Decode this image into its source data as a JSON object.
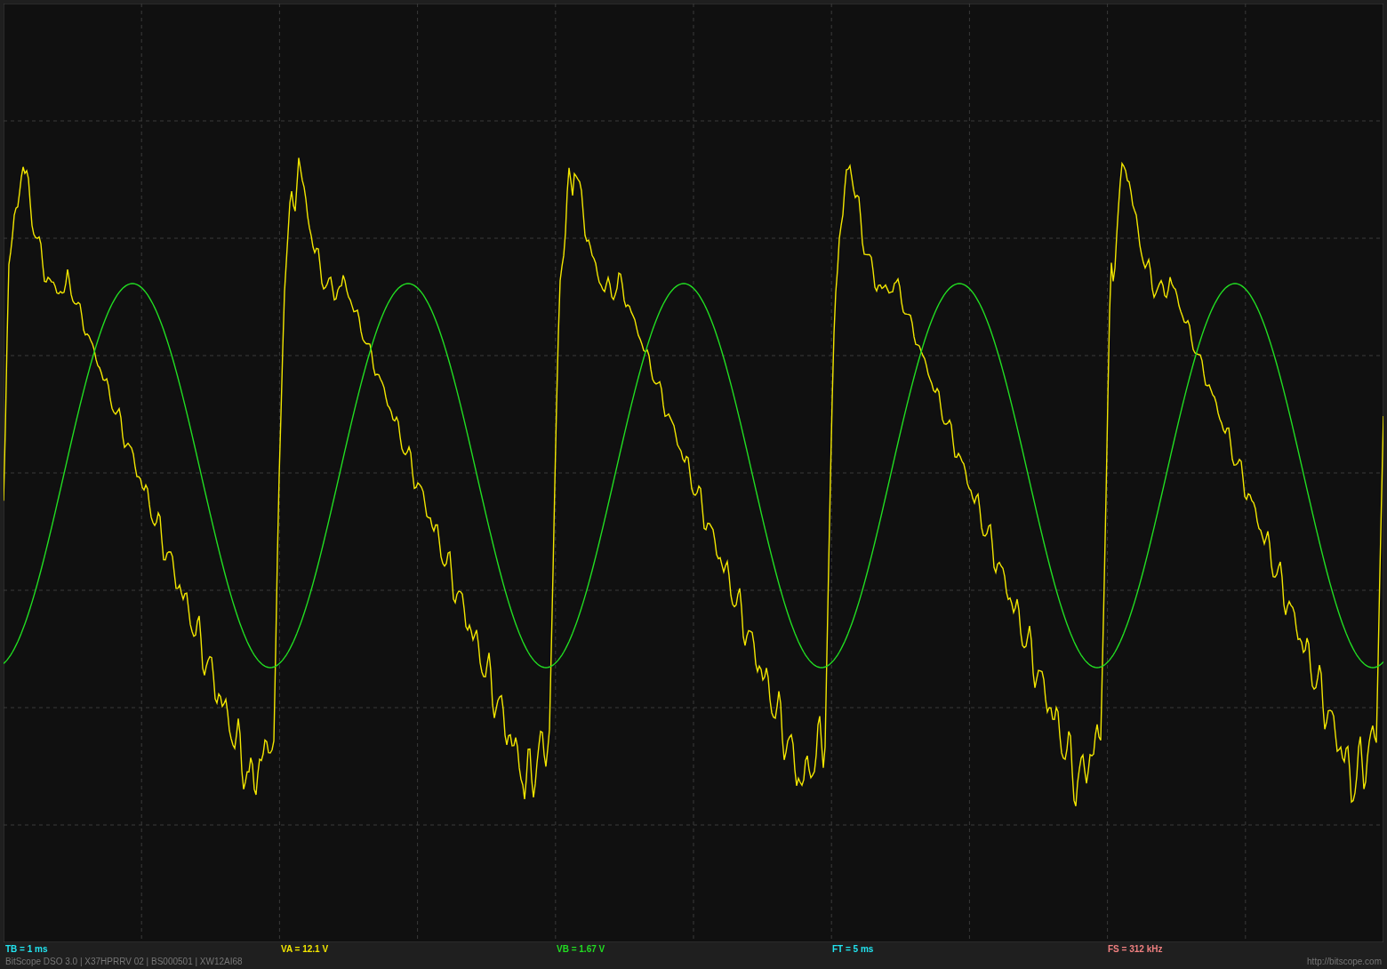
{
  "screen": {
    "traces": [
      {
        "kind": "sawtooth",
        "color": "#f2e600"
      },
      {
        "kind": "sine",
        "color": "#22dd22"
      }
    ]
  },
  "readouts": [
    {
      "text": "TB = 1 ms",
      "color": "#22e5f0"
    },
    {
      "text": "VA = 12.1 V",
      "color": "#f2e600"
    },
    {
      "text": "VB = 1.67 V",
      "color": "#22dd22"
    },
    {
      "text": "FT = 5 ms",
      "color": "#22e5f0"
    },
    {
      "text": "FS = 312 kHz",
      "color": "#f08080"
    }
  ],
  "footer": {
    "info": "BitScope DSO 3.0 | X37HPRRV 02 | BS000501 | XW12AI68",
    "url": "http://bitscope.com"
  }
}
